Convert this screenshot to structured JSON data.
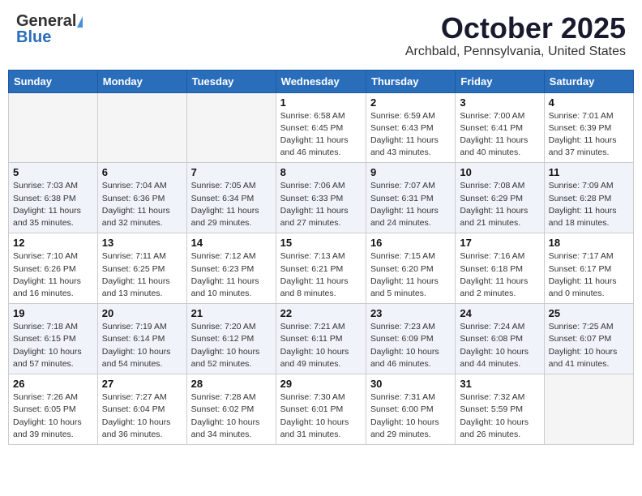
{
  "header": {
    "logo_general": "General",
    "logo_blue": "Blue",
    "month_title": "October 2025",
    "location": "Archbald, Pennsylvania, United States"
  },
  "weekdays": [
    "Sunday",
    "Monday",
    "Tuesday",
    "Wednesday",
    "Thursday",
    "Friday",
    "Saturday"
  ],
  "weeks": [
    [
      {
        "day": "",
        "detail": ""
      },
      {
        "day": "",
        "detail": ""
      },
      {
        "day": "",
        "detail": ""
      },
      {
        "day": "1",
        "detail": "Sunrise: 6:58 AM\nSunset: 6:45 PM\nDaylight: 11 hours\nand 46 minutes."
      },
      {
        "day": "2",
        "detail": "Sunrise: 6:59 AM\nSunset: 6:43 PM\nDaylight: 11 hours\nand 43 minutes."
      },
      {
        "day": "3",
        "detail": "Sunrise: 7:00 AM\nSunset: 6:41 PM\nDaylight: 11 hours\nand 40 minutes."
      },
      {
        "day": "4",
        "detail": "Sunrise: 7:01 AM\nSunset: 6:39 PM\nDaylight: 11 hours\nand 37 minutes."
      }
    ],
    [
      {
        "day": "5",
        "detail": "Sunrise: 7:03 AM\nSunset: 6:38 PM\nDaylight: 11 hours\nand 35 minutes."
      },
      {
        "day": "6",
        "detail": "Sunrise: 7:04 AM\nSunset: 6:36 PM\nDaylight: 11 hours\nand 32 minutes."
      },
      {
        "day": "7",
        "detail": "Sunrise: 7:05 AM\nSunset: 6:34 PM\nDaylight: 11 hours\nand 29 minutes."
      },
      {
        "day": "8",
        "detail": "Sunrise: 7:06 AM\nSunset: 6:33 PM\nDaylight: 11 hours\nand 27 minutes."
      },
      {
        "day": "9",
        "detail": "Sunrise: 7:07 AM\nSunset: 6:31 PM\nDaylight: 11 hours\nand 24 minutes."
      },
      {
        "day": "10",
        "detail": "Sunrise: 7:08 AM\nSunset: 6:29 PM\nDaylight: 11 hours\nand 21 minutes."
      },
      {
        "day": "11",
        "detail": "Sunrise: 7:09 AM\nSunset: 6:28 PM\nDaylight: 11 hours\nand 18 minutes."
      }
    ],
    [
      {
        "day": "12",
        "detail": "Sunrise: 7:10 AM\nSunset: 6:26 PM\nDaylight: 11 hours\nand 16 minutes."
      },
      {
        "day": "13",
        "detail": "Sunrise: 7:11 AM\nSunset: 6:25 PM\nDaylight: 11 hours\nand 13 minutes."
      },
      {
        "day": "14",
        "detail": "Sunrise: 7:12 AM\nSunset: 6:23 PM\nDaylight: 11 hours\nand 10 minutes."
      },
      {
        "day": "15",
        "detail": "Sunrise: 7:13 AM\nSunset: 6:21 PM\nDaylight: 11 hours\nand 8 minutes."
      },
      {
        "day": "16",
        "detail": "Sunrise: 7:15 AM\nSunset: 6:20 PM\nDaylight: 11 hours\nand 5 minutes."
      },
      {
        "day": "17",
        "detail": "Sunrise: 7:16 AM\nSunset: 6:18 PM\nDaylight: 11 hours\nand 2 minutes."
      },
      {
        "day": "18",
        "detail": "Sunrise: 7:17 AM\nSunset: 6:17 PM\nDaylight: 11 hours\nand 0 minutes."
      }
    ],
    [
      {
        "day": "19",
        "detail": "Sunrise: 7:18 AM\nSunset: 6:15 PM\nDaylight: 10 hours\nand 57 minutes."
      },
      {
        "day": "20",
        "detail": "Sunrise: 7:19 AM\nSunset: 6:14 PM\nDaylight: 10 hours\nand 54 minutes."
      },
      {
        "day": "21",
        "detail": "Sunrise: 7:20 AM\nSunset: 6:12 PM\nDaylight: 10 hours\nand 52 minutes."
      },
      {
        "day": "22",
        "detail": "Sunrise: 7:21 AM\nSunset: 6:11 PM\nDaylight: 10 hours\nand 49 minutes."
      },
      {
        "day": "23",
        "detail": "Sunrise: 7:23 AM\nSunset: 6:09 PM\nDaylight: 10 hours\nand 46 minutes."
      },
      {
        "day": "24",
        "detail": "Sunrise: 7:24 AM\nSunset: 6:08 PM\nDaylight: 10 hours\nand 44 minutes."
      },
      {
        "day": "25",
        "detail": "Sunrise: 7:25 AM\nSunset: 6:07 PM\nDaylight: 10 hours\nand 41 minutes."
      }
    ],
    [
      {
        "day": "26",
        "detail": "Sunrise: 7:26 AM\nSunset: 6:05 PM\nDaylight: 10 hours\nand 39 minutes."
      },
      {
        "day": "27",
        "detail": "Sunrise: 7:27 AM\nSunset: 6:04 PM\nDaylight: 10 hours\nand 36 minutes."
      },
      {
        "day": "28",
        "detail": "Sunrise: 7:28 AM\nSunset: 6:02 PM\nDaylight: 10 hours\nand 34 minutes."
      },
      {
        "day": "29",
        "detail": "Sunrise: 7:30 AM\nSunset: 6:01 PM\nDaylight: 10 hours\nand 31 minutes."
      },
      {
        "day": "30",
        "detail": "Sunrise: 7:31 AM\nSunset: 6:00 PM\nDaylight: 10 hours\nand 29 minutes."
      },
      {
        "day": "31",
        "detail": "Sunrise: 7:32 AM\nSunset: 5:59 PM\nDaylight: 10 hours\nand 26 minutes."
      },
      {
        "day": "",
        "detail": ""
      }
    ]
  ]
}
